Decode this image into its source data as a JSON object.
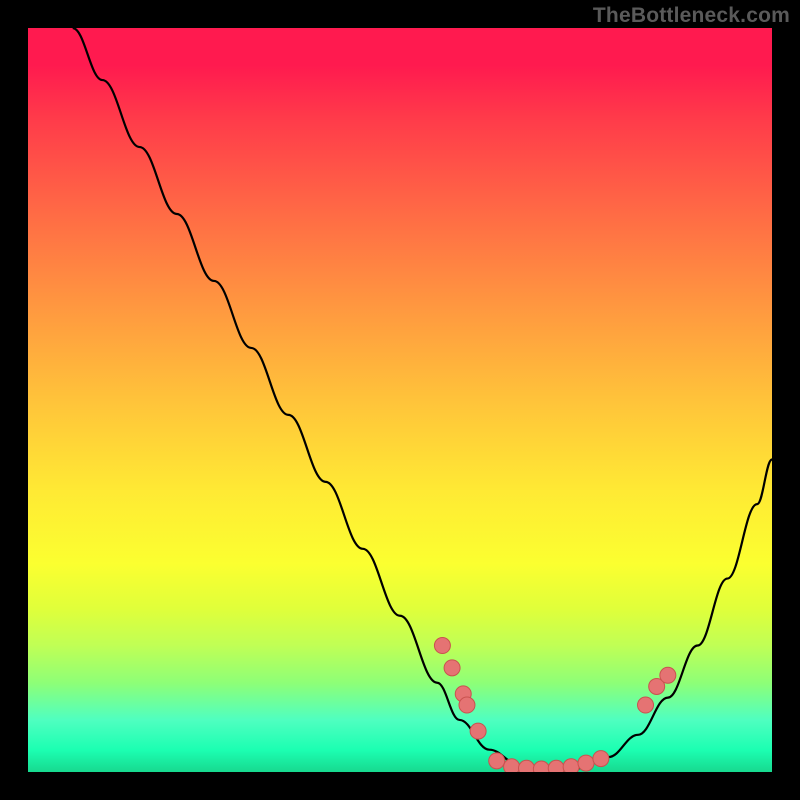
{
  "watermark": "TheBottleneck.com",
  "chart_data": {
    "type": "line",
    "title": "",
    "xlabel": "",
    "ylabel": "",
    "xlim": [
      0,
      100
    ],
    "ylim": [
      0,
      100
    ],
    "series": [
      {
        "name": "curve",
        "x": [
          6,
          10,
          15,
          20,
          25,
          30,
          35,
          40,
          45,
          50,
          55,
          58,
          62,
          66,
          70,
          74,
          78,
          82,
          86,
          90,
          94,
          98,
          100
        ],
        "y": [
          100,
          93,
          84,
          75,
          66,
          57,
          48,
          39,
          30,
          21,
          12,
          7,
          3,
          1,
          0,
          0.5,
          2,
          5,
          10,
          17,
          26,
          36,
          42
        ]
      }
    ],
    "marker_points": [
      {
        "x": 55.7,
        "y": 17
      },
      {
        "x": 57,
        "y": 14
      },
      {
        "x": 58.5,
        "y": 10.5
      },
      {
        "x": 59,
        "y": 9
      },
      {
        "x": 60.5,
        "y": 5.5
      },
      {
        "x": 63,
        "y": 1.5
      },
      {
        "x": 65,
        "y": 0.7
      },
      {
        "x": 67,
        "y": 0.5
      },
      {
        "x": 69,
        "y": 0.4
      },
      {
        "x": 71,
        "y": 0.5
      },
      {
        "x": 73,
        "y": 0.7
      },
      {
        "x": 75,
        "y": 1.2
      },
      {
        "x": 77,
        "y": 1.8
      },
      {
        "x": 83,
        "y": 9
      },
      {
        "x": 84.5,
        "y": 11.5
      },
      {
        "x": 86,
        "y": 13
      }
    ],
    "colors": {
      "curve": "#000000",
      "marker_fill": "#e57373",
      "marker_stroke": "#c9524f",
      "gradient_top": "#ff1a4f",
      "gradient_bottom": "#17d98f"
    }
  }
}
